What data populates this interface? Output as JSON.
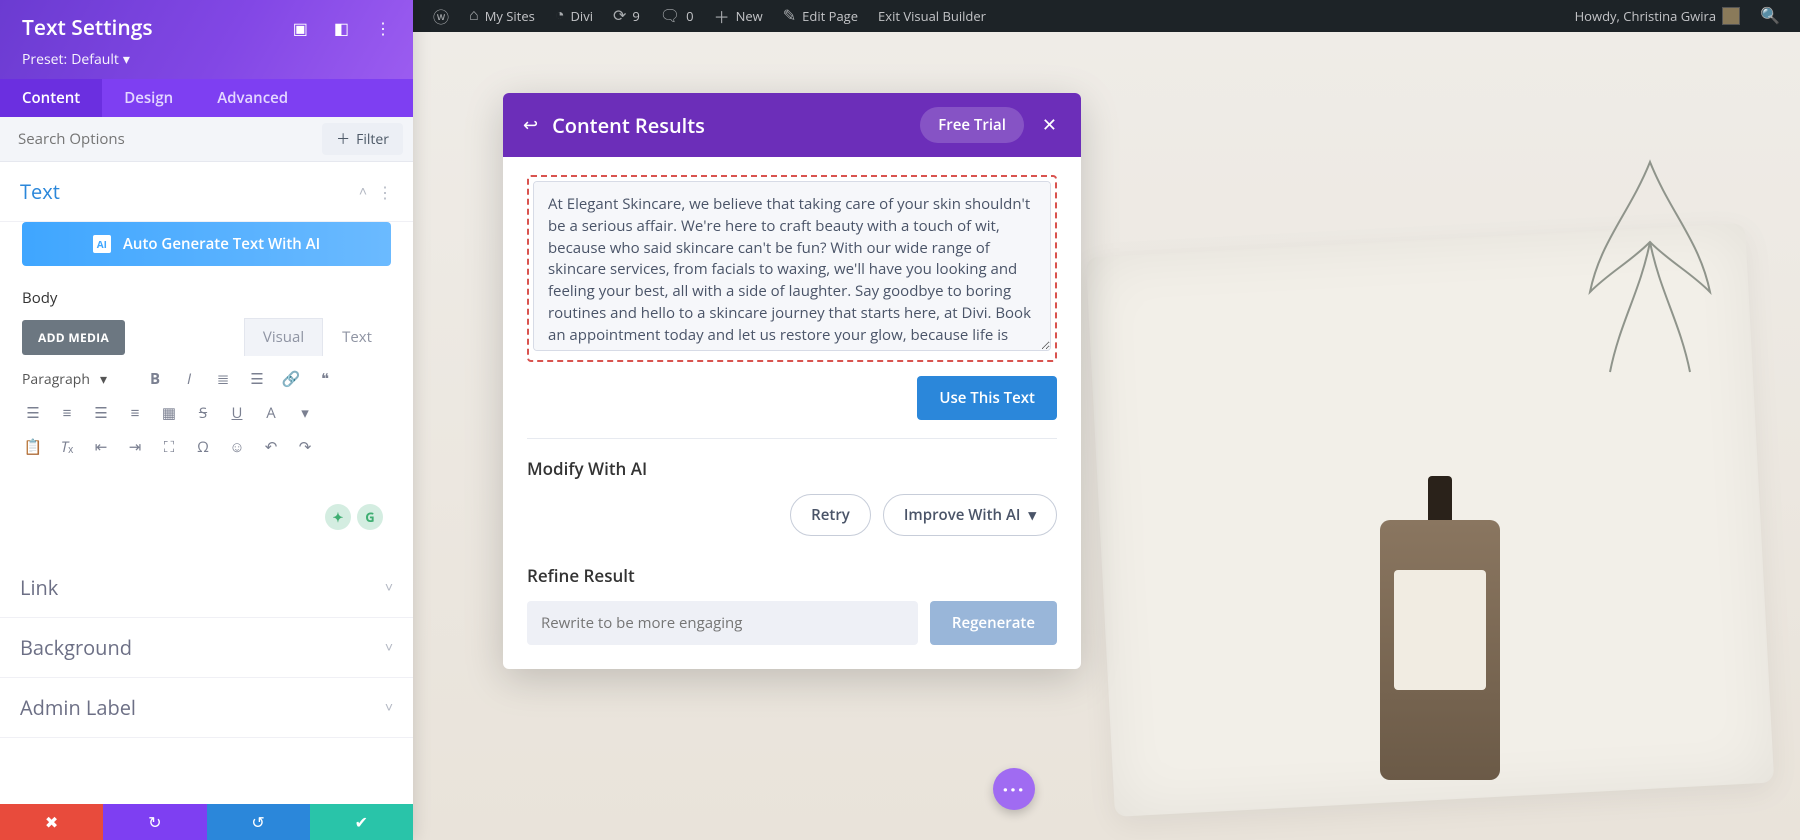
{
  "admin_bar": {
    "my_sites": "My Sites",
    "site_name": "Divi",
    "updates": "9",
    "comments": "0",
    "new": "New",
    "edit_page": "Edit Page",
    "exit_vb": "Exit Visual Builder",
    "howdy": "Howdy, Christina Gwira"
  },
  "panel": {
    "title": "Text Settings",
    "preset_label": "Preset:",
    "preset_value": "Default",
    "tabs": {
      "content": "Content",
      "design": "Design",
      "advanced": "Advanced"
    },
    "search_placeholder": "Search Options",
    "filter": "Filter",
    "sections": {
      "text": "Text",
      "link": "Link",
      "background": "Background",
      "admin_label": "Admin Label"
    },
    "autogen": "Auto Generate Text With AI",
    "body_label": "Body",
    "add_media": "ADD MEDIA",
    "editor_tabs": {
      "visual": "Visual",
      "text": "Text"
    },
    "paragraph": "Paragraph"
  },
  "modal": {
    "title": "Content Results",
    "free_trial": "Free Trial",
    "generated_text": "At Elegant Skincare, we believe that taking care of your skin shouldn't be a serious affair. We're here to craft beauty with a touch of wit, because who said skincare can't be fun? With our wide range of skincare services, from facials to waxing, we'll have you looking and feeling your best, all with a side of laughter. Say goodbye to boring routines and hello to a skincare journey that starts here, at Divi. Book an appointment today and let us restore your glow, because life is just better when your skin is elegant and your smile is radiant.",
    "use_this_text": "Use This Text",
    "modify_head": "Modify With AI",
    "retry": "Retry",
    "improve": "Improve With AI",
    "refine_head": "Refine Result",
    "refine_placeholder": "Rewrite to be more engaging",
    "regenerate": "Regenerate"
  }
}
